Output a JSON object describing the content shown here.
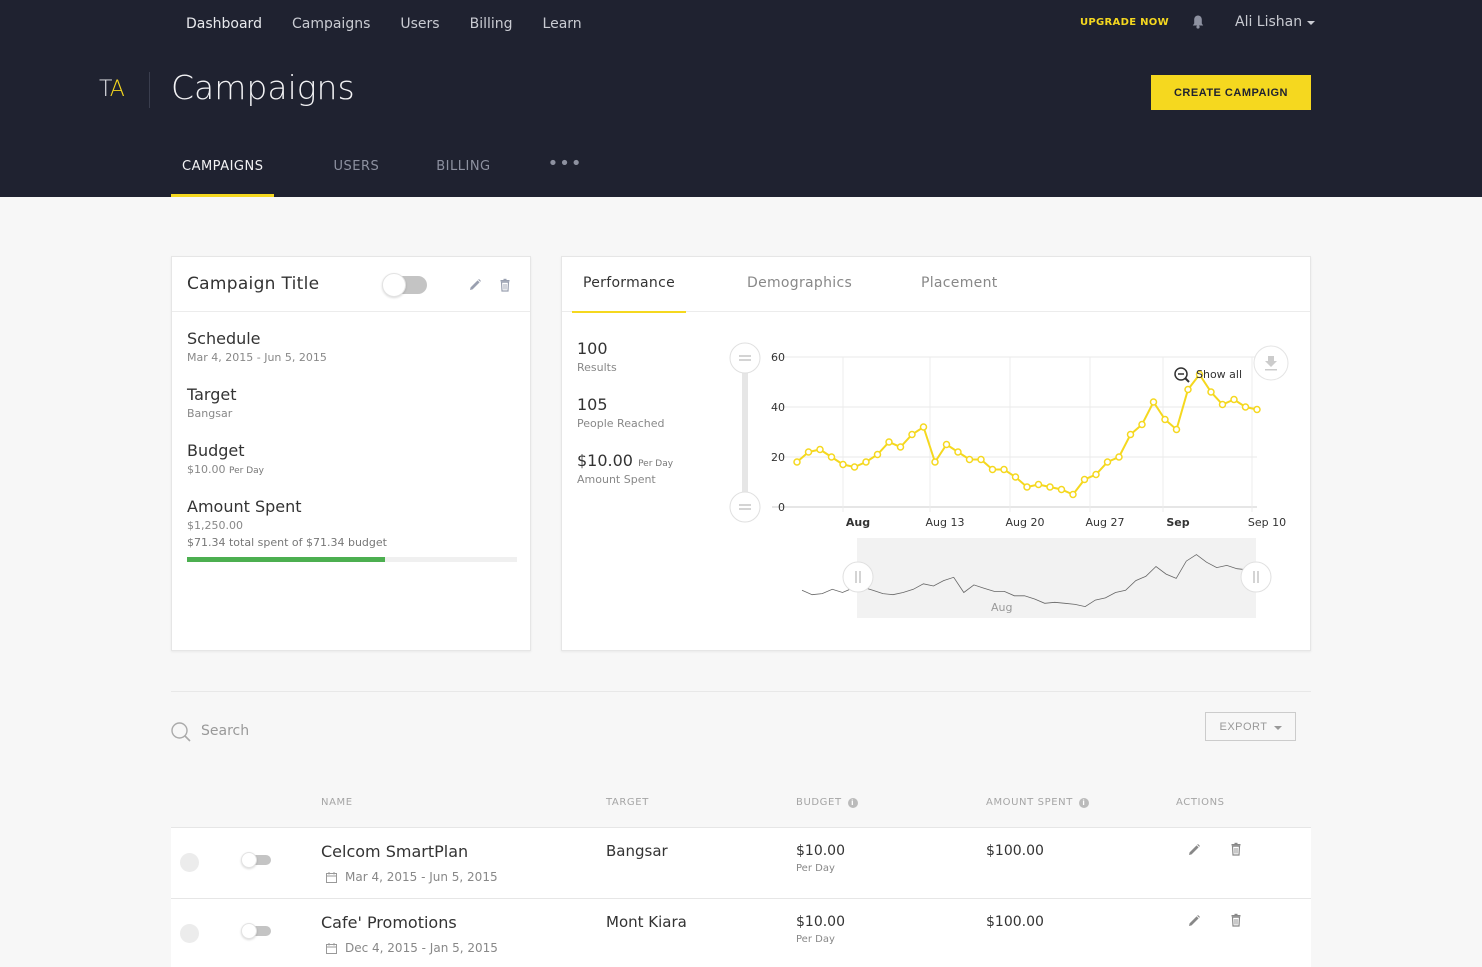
{
  "nav": {
    "items": [
      "Dashboard",
      "Campaigns",
      "Users",
      "Billing",
      "Learn"
    ],
    "upgrade": "UPGRADE NOW",
    "user": "Ali Lishan"
  },
  "header": {
    "logo_t": "T",
    "logo_a": "A",
    "title": "Campaigns",
    "create_button": "CREATE CAMPAIGN",
    "tabs": [
      "CAMPAIGNS",
      "USERS",
      "BILLING"
    ],
    "more": "•••"
  },
  "campaign_card": {
    "title": "Campaign Title",
    "schedule_label": "Schedule",
    "schedule_value": "Mar 4, 2015 - Jun 5, 2015",
    "target_label": "Target",
    "target_value": "Bangsar",
    "budget_label": "Budget",
    "budget_value": "$10.00",
    "budget_unit": "Per Day",
    "spent_label": "Amount Spent",
    "spent_value": "$1,250.00",
    "spent_note": "$71.34 total spent of $71.34 budget",
    "progress": 0.6
  },
  "performance": {
    "tabs": [
      "Performance",
      "Demographics",
      "Placement"
    ],
    "stats": [
      {
        "num": "100",
        "unit": "",
        "caption": "Results"
      },
      {
        "num": "105",
        "unit": "",
        "caption": "People Reached"
      },
      {
        "num": "$10.00",
        "unit": "Per Day",
        "caption": "Amount Spent"
      }
    ],
    "show_all": "Show all"
  },
  "chart_data": {
    "type": "line",
    "y_ticks": [
      "0",
      "20",
      "40",
      "60"
    ],
    "x_ticks": [
      "Aug",
      "Aug 13",
      "Aug 20",
      "Aug 27",
      "Sep",
      "Sep 10"
    ],
    "ylim": [
      0,
      60
    ],
    "series": [
      {
        "values": [
          18,
          22,
          23,
          20,
          17,
          16,
          18,
          21,
          26,
          24,
          29,
          32,
          18,
          25,
          22,
          19,
          19,
          15,
          15,
          12,
          8,
          9,
          8,
          7,
          5,
          11,
          13,
          18,
          20,
          29,
          33,
          42,
          35,
          31,
          47,
          53,
          46,
          41,
          43,
          40,
          39
        ]
      }
    ],
    "navigator_label": "Aug",
    "color": "#f5d81f"
  },
  "list": {
    "search_placeholder": "Search",
    "export": "EXPORT",
    "columns": [
      "NAME",
      "TARGET",
      "BUDGET",
      "AMOUNT SPENT",
      "ACTIONS"
    ],
    "rows": [
      {
        "name": "Celcom SmartPlan",
        "date": "Mar 4, 2015 - Jun 5, 2015",
        "target": "Bangsar",
        "budget": "$10.00",
        "budget_unit": "Per Day",
        "spent": "$100.00"
      },
      {
        "name": "Cafe' Promotions",
        "date": "Dec 4, 2015 - Jan 5, 2015",
        "target": "Mont Kiara",
        "budget": "$10.00",
        "budget_unit": "Per Day",
        "spent": "$100.00"
      }
    ]
  }
}
